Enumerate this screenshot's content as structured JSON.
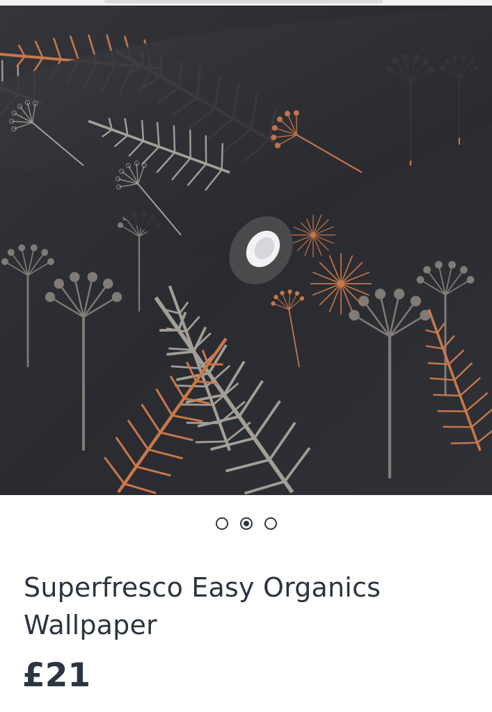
{
  "product": {
    "title": "Superfresco Easy Organics Wallpaper",
    "price": "£21",
    "image": {
      "icon": "wallpaper-roll-image",
      "background_color": "#2c2d31",
      "accent_color": "#c9784a",
      "motif_color": "#9a958d"
    }
  },
  "carousel": {
    "slide_count": 3,
    "active_index": 1
  },
  "colors": {
    "text": "#2b3440",
    "dot": "#2f3640"
  }
}
